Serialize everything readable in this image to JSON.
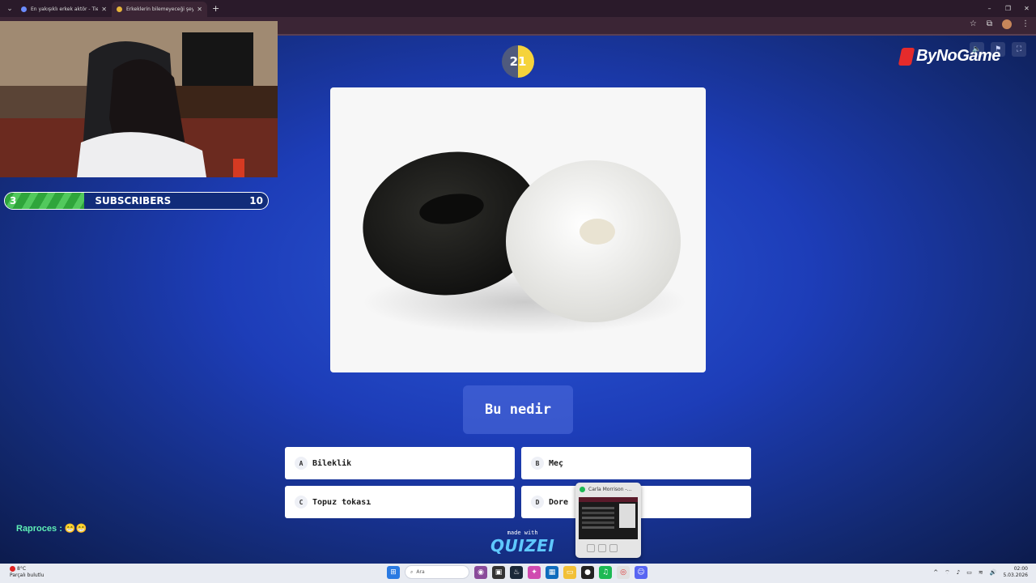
{
  "browser": {
    "tabs": [
      {
        "label": "En yakışıklı erkek aktör - Tier Li",
        "active": false
      },
      {
        "label": "Erkeklerin bilemeyeceği şeyler",
        "active": true
      }
    ],
    "new_tab": "+",
    "window_controls": [
      "–",
      "❐",
      "✕"
    ]
  },
  "game": {
    "timer": "21",
    "brand": "ByNoGame",
    "question": "Bu nedir",
    "answers": [
      {
        "letter": "A",
        "text": "Bileklik"
      },
      {
        "letter": "B",
        "text": "Meç"
      },
      {
        "letter": "C",
        "text": "Topuz tokası"
      },
      {
        "letter": "D",
        "text": "Dore"
      }
    ],
    "made_with": "made with",
    "made_with_logo": "QUIZEI"
  },
  "overlay": {
    "subscribers_current": "3",
    "subscribers_label": "SUBSCRIBERS",
    "subscribers_goal": "10",
    "subscribers_progress": 0.3,
    "chat_user": "Raproces :",
    "chat_message": "😁😁"
  },
  "media_popup": {
    "title": "Carla Morrison -..."
  },
  "taskbar": {
    "weather_temp": "8°C",
    "weather_desc": "Parçalı bulutlu",
    "search_placeholder": "Ara",
    "time": "02:00",
    "date": "5.03.2026"
  }
}
